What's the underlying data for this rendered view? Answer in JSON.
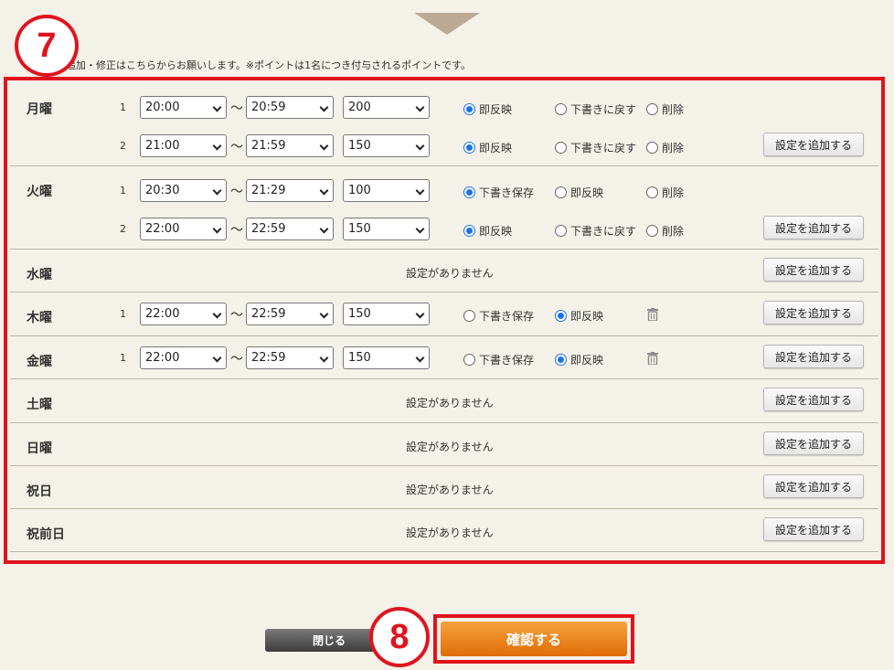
{
  "notice": "追加・修正はこちらからお願いします。※ポイントは1名につき付与されるポイントです。",
  "badges": {
    "step7": "7",
    "step8": "8"
  },
  "tilde": "〜",
  "no_setting": "設定がありません",
  "add_label": "設定を追加する",
  "days": [
    {
      "label": "月曜",
      "entries": [
        {
          "num": "1",
          "start": "20:00",
          "end": "20:59",
          "points": "200",
          "radios": [
            {
              "label": "即反映",
              "on": true
            },
            {
              "label": "下書きに戻す",
              "on": false
            },
            {
              "label": "削除",
              "on": false
            }
          ]
        },
        {
          "num": "2",
          "start": "21:00",
          "end": "21:59",
          "points": "150",
          "radios": [
            {
              "label": "即反映",
              "on": true
            },
            {
              "label": "下書きに戻す",
              "on": false
            },
            {
              "label": "削除",
              "on": false
            }
          ]
        }
      ]
    },
    {
      "label": "火曜",
      "entries": [
        {
          "num": "1",
          "start": "20:30",
          "end": "21:29",
          "points": "100",
          "radios": [
            {
              "label": "下書き保存",
              "on": true
            },
            {
              "label": "即反映",
              "on": false
            },
            {
              "label": "削除",
              "on": false
            }
          ]
        },
        {
          "num": "2",
          "start": "22:00",
          "end": "22:59",
          "points": "150",
          "radios": [
            {
              "label": "即反映",
              "on": true
            },
            {
              "label": "下書きに戻す",
              "on": false
            },
            {
              "label": "削除",
              "on": false
            }
          ]
        }
      ]
    },
    {
      "label": "水曜",
      "entries": []
    },
    {
      "label": "木曜",
      "entries": [
        {
          "num": "1",
          "start": "22:00",
          "end": "22:59",
          "points": "150",
          "radios": [
            {
              "label": "下書き保存",
              "on": false
            },
            {
              "label": "即反映",
              "on": true
            }
          ]
        }
      ]
    },
    {
      "label": "金曜",
      "entries": [
        {
          "num": "1",
          "start": "22:00",
          "end": "22:59",
          "points": "150",
          "radios": [
            {
              "label": "下書き保存",
              "on": false
            },
            {
              "label": "即反映",
              "on": true
            }
          ]
        }
      ]
    },
    {
      "label": "土曜",
      "entries": []
    },
    {
      "label": "日曜",
      "entries": []
    },
    {
      "label": "祝日",
      "entries": []
    },
    {
      "label": "祝前日",
      "entries": []
    }
  ],
  "footer": {
    "close_label": "閉じる",
    "confirm_label": "確認する"
  },
  "colors": {
    "accent_red": "#e0141e",
    "confirm_orange": "#e87a10",
    "radio_blue": "#1a73e8"
  }
}
